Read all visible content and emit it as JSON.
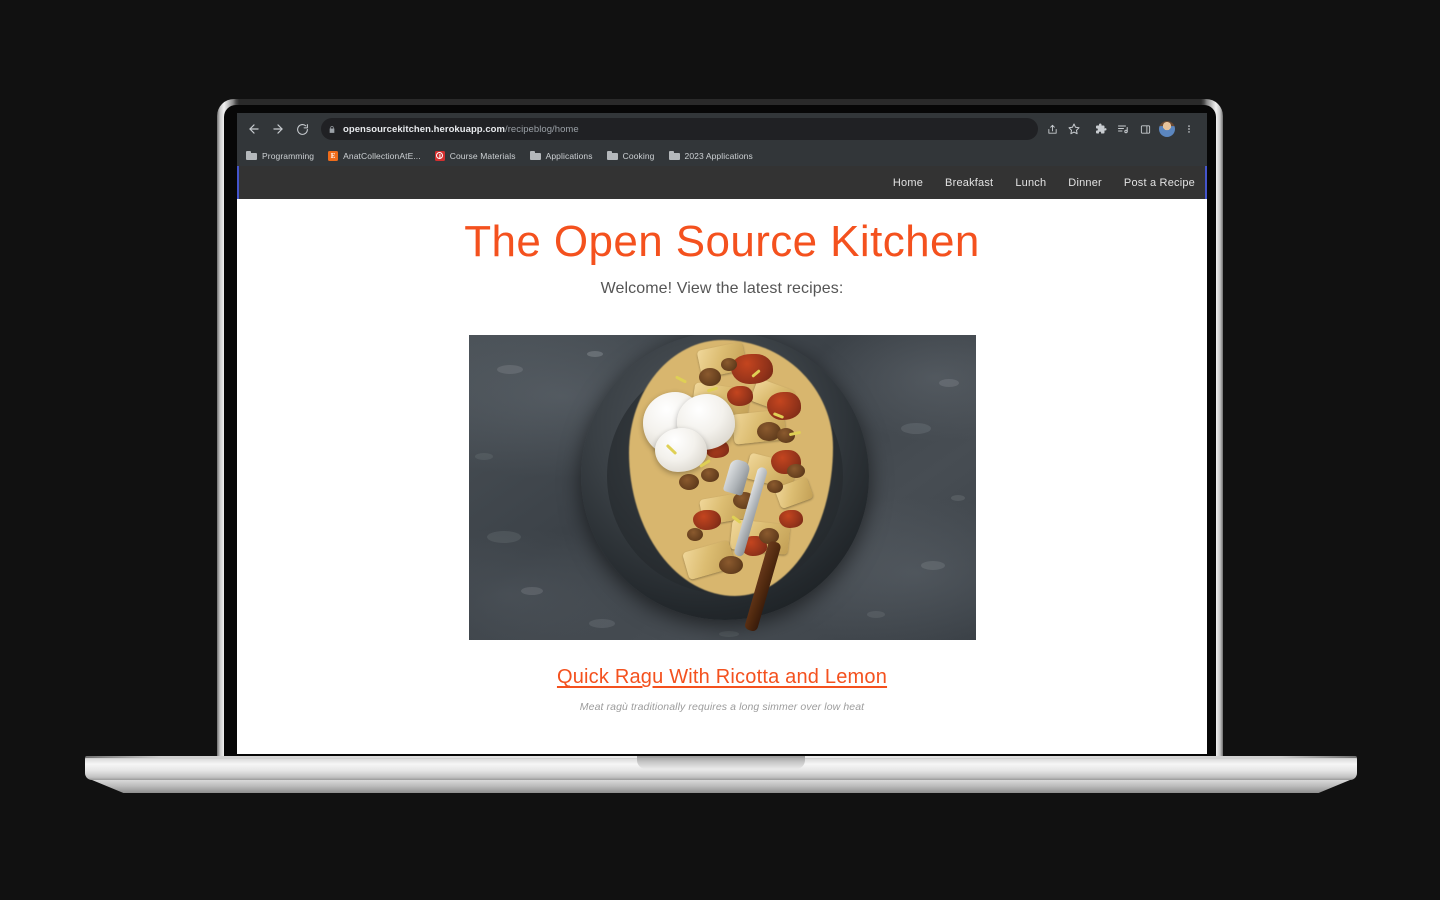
{
  "browser": {
    "back_icon": "back-arrow-icon",
    "forward_icon": "forward-arrow-icon",
    "reload_icon": "reload-icon",
    "lock_icon": "lock-icon",
    "url_host": "opensourcekitchen.herokuapp.com",
    "url_path": "/recipeblog/home",
    "toolbar_icons": [
      "share-icon",
      "bookmark-star-icon",
      "extensions-puzzle-icon",
      "reading-list-icon",
      "side-panel-icon",
      "profile-avatar",
      "chrome-menu-icon"
    ],
    "bookmarks": [
      {
        "label": "Programming",
        "icon": "folder-icon",
        "icon_type": "folder"
      },
      {
        "label": "AnatCollectionAtE...",
        "icon": "evernote-icon",
        "icon_type": "letter",
        "glyph": "E",
        "color": "#ef6c1a"
      },
      {
        "label": "Course Materials",
        "icon": "panopto-icon",
        "icon_type": "circle",
        "color": "#d32f2f"
      },
      {
        "label": "Applications",
        "icon": "folder-icon",
        "icon_type": "folder"
      },
      {
        "label": "Cooking",
        "icon": "folder-icon",
        "icon_type": "folder"
      },
      {
        "label": "2023 Applications",
        "icon": "folder-icon",
        "icon_type": "folder"
      }
    ]
  },
  "site": {
    "nav": [
      {
        "label": "Home"
      },
      {
        "label": "Breakfast"
      },
      {
        "label": "Lunch"
      },
      {
        "label": "Dinner"
      },
      {
        "label": "Post a Recipe"
      }
    ],
    "title": "The Open Source Kitchen",
    "welcome": "Welcome! View the latest recipes:",
    "accent_color": "#f4511e",
    "nav_bg_color": "#333333",
    "nav_border_color": "#4455cc",
    "recipe": {
      "image_alt": "Plate of pappardelle ragu topped with ricotta and lemon zest, with a fork",
      "title": "Quick Ragu With Ricotta and Lemon",
      "description": "Meat ragù traditionally requires a long simmer over low heat"
    }
  }
}
